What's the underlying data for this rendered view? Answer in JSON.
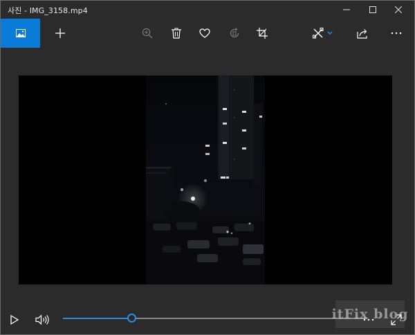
{
  "window": {
    "title": "사진 - IMG_3158.mp4",
    "accent_color": "#0a7bd6",
    "icons": {
      "minimize": "minimize-icon",
      "maximize": "maximize-icon",
      "close": "close-icon"
    }
  },
  "toolbar": {
    "items": [
      {
        "name": "photos-collection",
        "icon": "image-icon",
        "active": true
      },
      {
        "name": "add-to",
        "icon": "plus-icon"
      },
      {
        "name": "zoom",
        "icon": "zoom-in-icon",
        "enabled": false
      },
      {
        "name": "delete",
        "icon": "trash-icon"
      },
      {
        "name": "favorite",
        "icon": "heart-icon"
      },
      {
        "name": "rotate",
        "icon": "rotate-icon",
        "enabled": false
      },
      {
        "name": "crop",
        "icon": "crop-icon"
      },
      {
        "name": "edit-and-create",
        "icon": "edit-tools-icon",
        "has_dropdown": true
      },
      {
        "name": "share",
        "icon": "share-icon"
      },
      {
        "name": "see-more",
        "icon": "more-icon"
      }
    ]
  },
  "player": {
    "progress": 0.225,
    "seek_color": "#2b8ee6",
    "icons": {
      "play": "play-icon",
      "volume": "volume-icon",
      "more": "more-icon",
      "fullscreen": "fullscreen-icon"
    }
  },
  "watermark": {
    "text": "itFix blog"
  }
}
